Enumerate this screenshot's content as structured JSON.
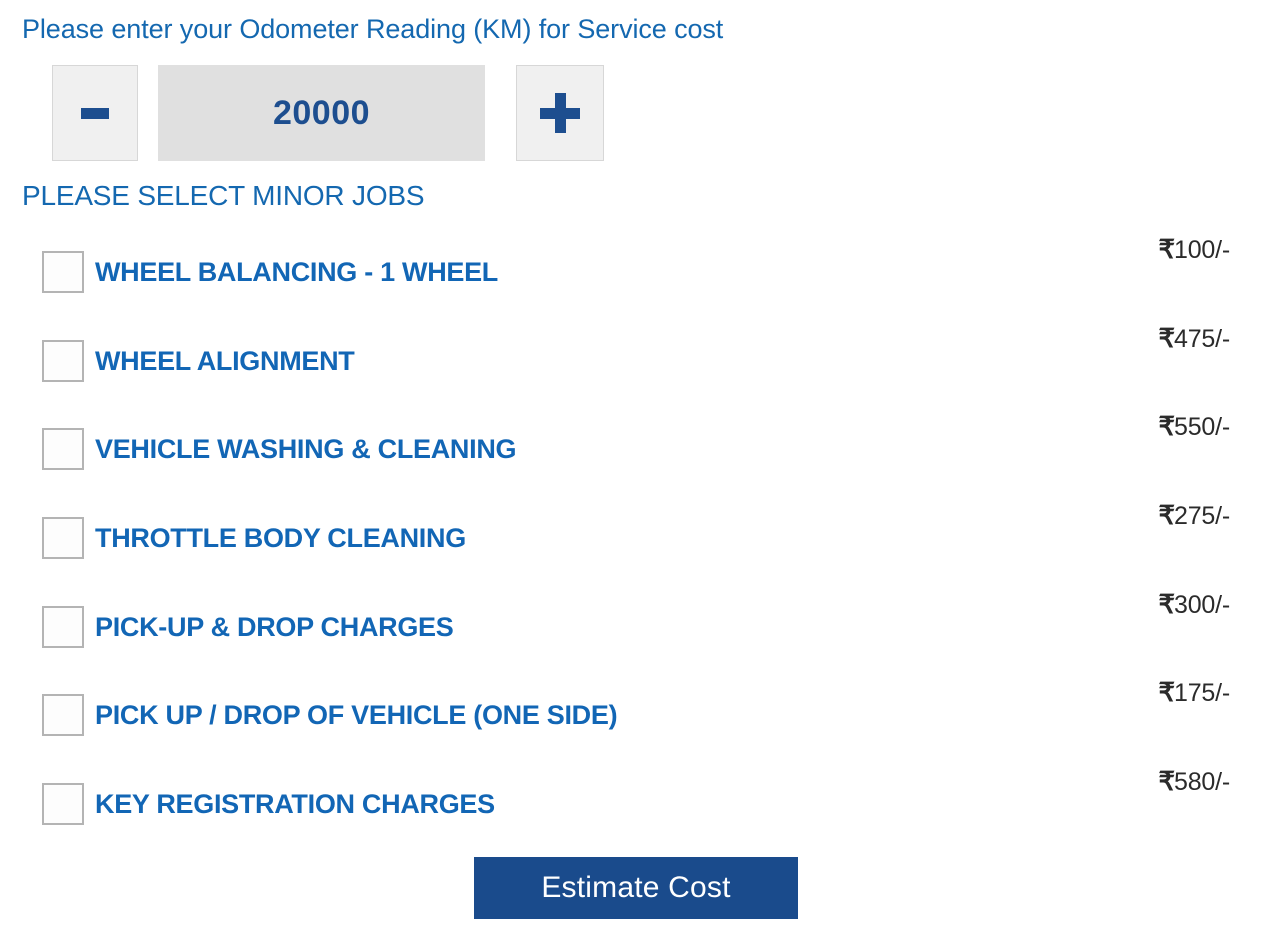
{
  "form": {
    "odometer_prompt": "Please enter your Odometer Reading (KM) for Service cost",
    "stepper": {
      "decrement_label": "-",
      "increment_label": "+",
      "value": "20000",
      "placeholder": "20000"
    },
    "section_heading": "PLEASE SELECT MINOR JOBS",
    "submit_label": "Estimate Cost",
    "currency_symbol": "₹",
    "price_suffix": "/-",
    "colors": {
      "heading_blue": "#1468b0",
      "label_blue": "#1266b5",
      "accent_navy": "#1d4e8f",
      "button_blue": "#1a4b8c",
      "price_text": "#2b2b2b",
      "stepper_button_bg": "#f0f0f0",
      "stepper_value_bg": "#e0e0e0",
      "checkbox_border": "#b4b4b4"
    },
    "jobs": [
      {
        "label": "WHEEL BALANCING - 1 WHEEL",
        "amount": "100",
        "price": "₹100/-",
        "checked": false
      },
      {
        "label": "WHEEL ALIGNMENT",
        "amount": "475",
        "price": "₹475/-",
        "checked": false
      },
      {
        "label": "VEHICLE WASHING & CLEANING",
        "amount": "550",
        "price": "₹550/-",
        "checked": false
      },
      {
        "label": "THROTTLE BODY CLEANING",
        "amount": "275",
        "price": "₹275/-",
        "checked": false
      },
      {
        "label": "PICK-UP & DROP CHARGES",
        "amount": "300",
        "price": "₹300/-",
        "checked": false
      },
      {
        "label": "PICK UP / DROP OF VEHICLE (ONE SIDE)",
        "amount": "175",
        "price": "₹175/-",
        "checked": false
      },
      {
        "label": "KEY REGISTRATION CHARGES",
        "amount": "580",
        "price": "₹580/-",
        "checked": false
      }
    ]
  }
}
